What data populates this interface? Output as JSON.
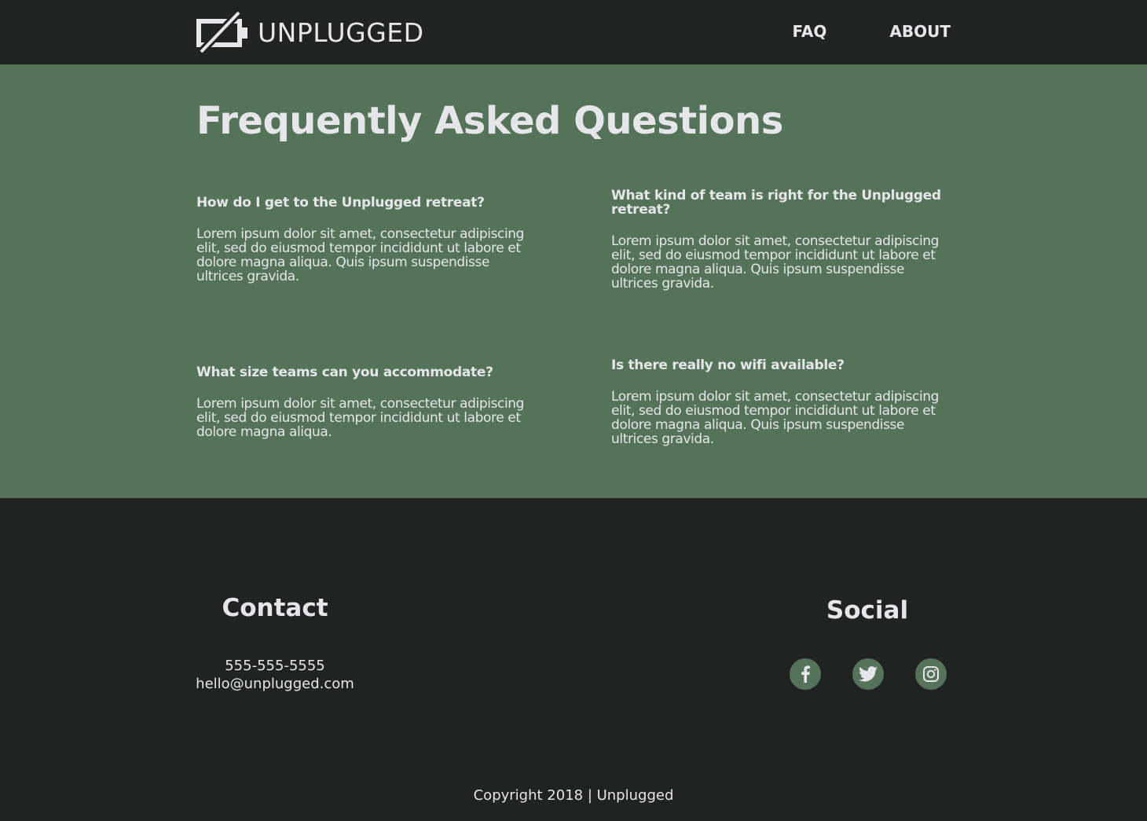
{
  "header": {
    "logo_text": "UNPLUGGED",
    "nav": [
      {
        "label": "FAQ"
      },
      {
        "label": "ABOUT"
      }
    ]
  },
  "faq": {
    "title": "Frequently Asked Questions",
    "items": [
      {
        "question": "How do I get to the Unplugged retreat?",
        "answer": "Lorem ipsum dolor sit amet, consectetur adipiscing elit, sed do eiusmod tempor incididunt ut labore et dolore magna aliqua. Quis ipsum suspendisse ultrices gravida."
      },
      {
        "question": "What kind of team is right for the Unplugged retreat?",
        "answer": "Lorem ipsum dolor sit amet, consectetur adipiscing elit, sed do eiusmod tempor incididunt ut labore et dolore magna aliqua. Quis ipsum suspendisse ultrices gravida."
      },
      {
        "question": "What size teams can you accommodate?",
        "answer": "Lorem ipsum dolor sit amet, consectetur adipiscing elit, sed do eiusmod tempor incididunt ut labore et dolore magna aliqua."
      },
      {
        "question": "Is there really no wifi available?",
        "answer": "Lorem ipsum dolor sit amet, consectetur adipiscing elit, sed do eiusmod tempor incididunt ut labore et dolore magna aliqua. Quis ipsum suspendisse ultrices gravida."
      }
    ]
  },
  "footer": {
    "contact_title": "Contact",
    "phone": "555-555-5555",
    "email": "hello@unplugged.com",
    "social_title": "Social",
    "social_icons": [
      "facebook-icon",
      "twitter-icon",
      "instagram-icon"
    ],
    "copyright": "Copyright 2018 | Unplugged"
  },
  "colors": {
    "dark_bg": "#212322",
    "accent_green": "#557359",
    "text": "#e6e6ea"
  }
}
